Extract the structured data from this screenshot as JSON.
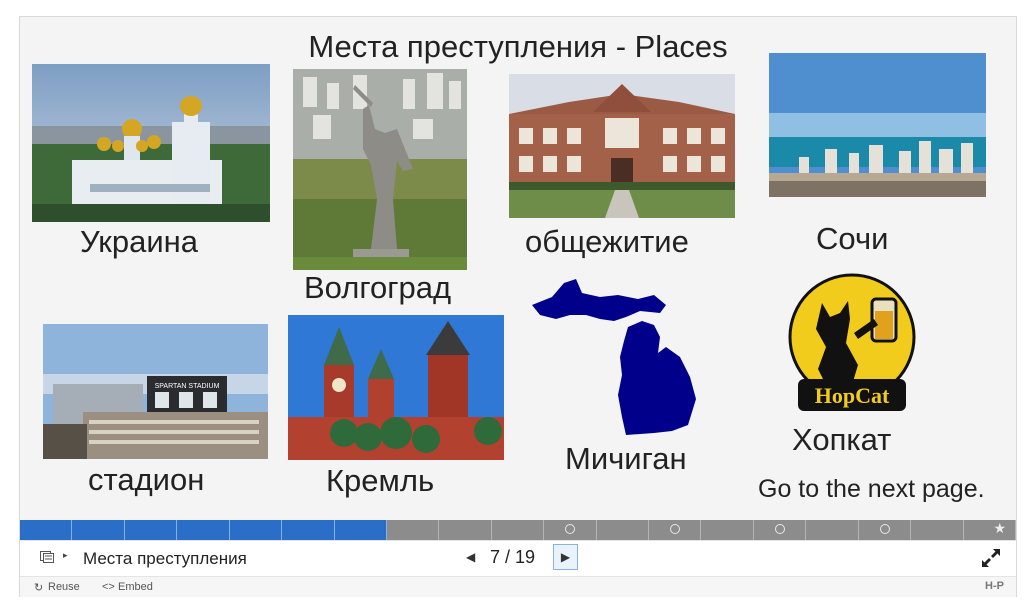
{
  "slide": {
    "title": "Места преступления - Places",
    "labels": {
      "ukraine": "Украина",
      "volgograd": "Волгоград",
      "dorm": "общежитие",
      "sochi": "Сочи",
      "stadium": "стадион",
      "kremlin": "Кремль",
      "michigan": "Мичиган",
      "hopcat": "Хопкат"
    },
    "hopcat_logo_text": "HopCat",
    "stadium_sign_text": "SPARTAN STADIUM",
    "next_page_text": "Go to the next page."
  },
  "progress": {
    "total_slides": 19,
    "current_slide": 7,
    "accent": "#2a6ec8"
  },
  "navbar": {
    "section_title": "Места преступления",
    "counter": "7 / 19"
  },
  "footer": {
    "reuse_label": "Reuse",
    "embed_label": "Embed",
    "brand": "H-P"
  },
  "icons": {
    "toc": "table-of-contents-icon",
    "prev": "prev-arrow-icon",
    "next": "next-arrow-icon",
    "fullscreen": "fullscreen-icon",
    "reuse": "reuse-icon",
    "embed": "embed-icon",
    "task": "task-star-icon"
  }
}
